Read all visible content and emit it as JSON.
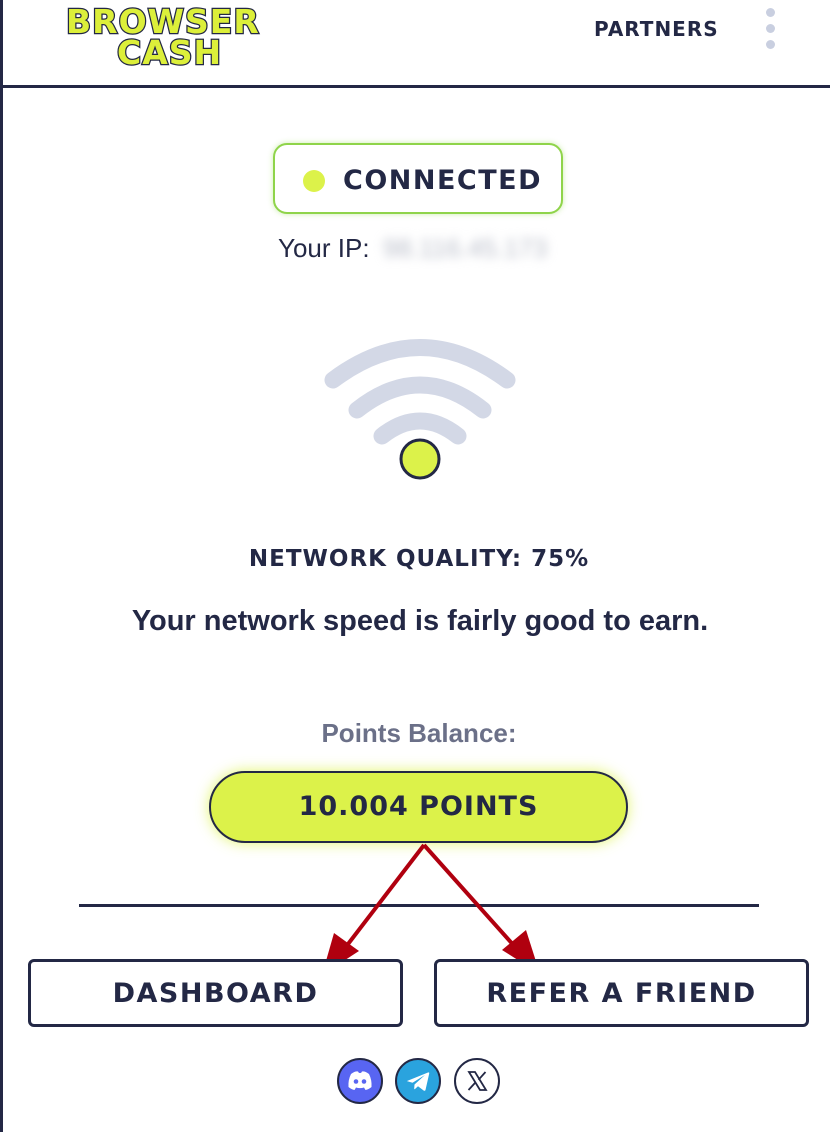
{
  "header": {
    "logo_line1": "BROWSER",
    "logo_line2": "CASH",
    "partners_label": "PARTNERS"
  },
  "status": {
    "label": "CONNECTED",
    "ip_label": "Your IP:",
    "ip_value": "98.116.45.173"
  },
  "network": {
    "quality_label": "NETWORK QUALITY: 75%",
    "quality_percent": 75,
    "message": "Your network speed is fairly good to earn."
  },
  "balance": {
    "label": "Points Balance:",
    "value": "10.004 POINTS"
  },
  "actions": {
    "dashboard_label": "DASHBOARD",
    "refer_label": "REFER A FRIEND"
  },
  "socials": [
    "discord-icon",
    "telegram-icon",
    "x-icon"
  ],
  "colors": {
    "navy": "#232845",
    "accent_lime": "#dcf24a",
    "connected_green": "#8fd44a",
    "wifi_gray": "#d3d8e6",
    "arrow_red": "#b0000f"
  }
}
